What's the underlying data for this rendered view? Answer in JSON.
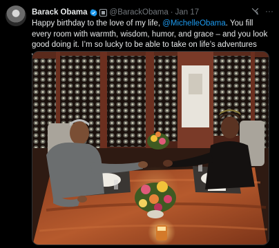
{
  "tweet": {
    "author_name": "Barack Obama",
    "handle": "@BarackObama",
    "separator": "·",
    "date": "Jan 17",
    "text_before": "Happy birthday to the love of my life, ",
    "mention": "@MichelleObama",
    "text_after": ". You fill every room with warmth, wisdom, humor, and grace – and you look good doing it. I’m so lucky to be able to take on life’s adventures with you. Love you!",
    "more_glyph": "···",
    "photo_alt": "Barack and Michelle Obama at a candlelit dinner table with a flower centerpiece, wine racks in the background"
  },
  "colors": {
    "background": "#000000",
    "text": "#e7e9ea",
    "secondary": "#71767b",
    "link": "#1d9bf0",
    "verified": "#1d9bf0"
  },
  "icons": {
    "verified": "verified-badge-icon",
    "gov": "government-badge-icon",
    "grok": "grok-icon",
    "more": "more-icon"
  }
}
